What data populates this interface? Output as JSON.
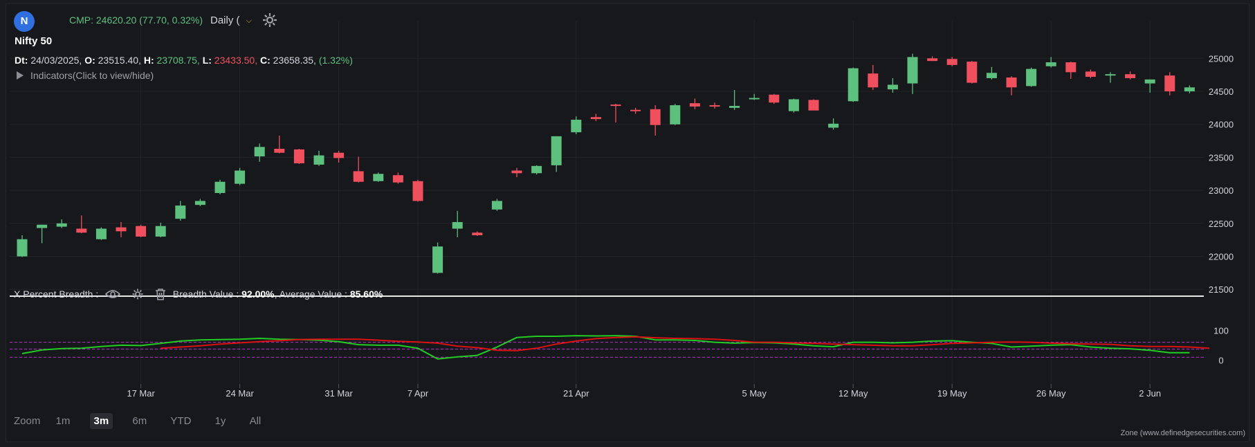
{
  "header": {
    "logo_letter": "N",
    "cmp_text": "CMP: 24620.20 (77.70, 0.32%)",
    "interval_label": "Daily (",
    "symbol_title": "Nifty 50"
  },
  "ohlc": {
    "dt_label": "Dt:",
    "dt_value": "24/03/2025,",
    "o_label": "O:",
    "o_value": "23515.40,",
    "h_label": "H:",
    "h_value": "23708.75,",
    "l_label": "L:",
    "l_value": "23433.50,",
    "c_label": "C:",
    "c_value": "23658.35,",
    "change": "(1.32%)"
  },
  "indicators_toggle": "Indicators(Click to view/hide)",
  "study": {
    "name": "X Percent Breadth :",
    "breadth_label": "Breadth Value :",
    "breadth_value": "92.00%",
    "sep": ", Average Value :",
    "average_value": "85.60%"
  },
  "zoom": {
    "label": "Zoom",
    "options": [
      "1m",
      "3m",
      "6m",
      "YTD",
      "1y",
      "All"
    ],
    "active": "3m"
  },
  "credit": "Zone (www.definedgesecurities.com)",
  "colors": {
    "up": "#5ec07f",
    "down": "#f0505e",
    "breadth_line": "#22cc22",
    "average_line": "#dd1111",
    "band_lines": "#c026d3"
  },
  "chart_data": [
    {
      "type": "candlestick",
      "title": "Nifty 50",
      "y_ticks": [
        21500,
        22000,
        22500,
        23000,
        23500,
        24000,
        24500,
        25000
      ],
      "ylim": [
        21450,
        25150
      ],
      "x_tick_labels": [
        "17 Mar",
        "24 Mar",
        "31 Mar",
        "7 Apr",
        "21 Apr",
        "5 May",
        "12 May",
        "19 May",
        "26 May",
        "2 Jun"
      ],
      "x_tick_session_index": [
        6,
        11,
        16,
        20,
        28,
        37,
        42,
        47,
        52,
        57
      ],
      "grid": true,
      "candles": [
        {
          "o": 22000,
          "h": 22320,
          "l": 21990,
          "c": 22260
        },
        {
          "o": 22430,
          "h": 22480,
          "l": 22200,
          "c": 22480
        },
        {
          "o": 22450,
          "h": 22560,
          "l": 22430,
          "c": 22500
        },
        {
          "o": 22420,
          "h": 22620,
          "l": 22350,
          "c": 22360
        },
        {
          "o": 22260,
          "h": 22440,
          "l": 22250,
          "c": 22420
        },
        {
          "o": 22440,
          "h": 22520,
          "l": 22290,
          "c": 22380
        },
        {
          "o": 22460,
          "h": 22480,
          "l": 22290,
          "c": 22300
        },
        {
          "o": 22300,
          "h": 22510,
          "l": 22290,
          "c": 22460
        },
        {
          "o": 22570,
          "h": 22840,
          "l": 22540,
          "c": 22770
        },
        {
          "o": 22780,
          "h": 22870,
          "l": 22760,
          "c": 22840
        },
        {
          "o": 22960,
          "h": 23160,
          "l": 22940,
          "c": 23130
        },
        {
          "o": 23100,
          "h": 23340,
          "l": 23080,
          "c": 23300
        },
        {
          "o": 23515,
          "h": 23709,
          "l": 23434,
          "c": 23658
        },
        {
          "o": 23630,
          "h": 23830,
          "l": 23560,
          "c": 23570
        },
        {
          "o": 23620,
          "h": 23630,
          "l": 23400,
          "c": 23410
        },
        {
          "o": 23390,
          "h": 23600,
          "l": 23370,
          "c": 23530
        },
        {
          "o": 23570,
          "h": 23600,
          "l": 23420,
          "c": 23490
        },
        {
          "o": 23290,
          "h": 23510,
          "l": 23120,
          "c": 23130
        },
        {
          "o": 23140,
          "h": 23270,
          "l": 23130,
          "c": 23250
        },
        {
          "o": 23230,
          "h": 23270,
          "l": 23100,
          "c": 23120
        },
        {
          "o": 23140,
          "h": 23160,
          "l": 22830,
          "c": 22840
        },
        {
          "o": 21750,
          "h": 22210,
          "l": 21740,
          "c": 22150
        },
        {
          "o": 22420,
          "h": 22690,
          "l": 22290,
          "c": 22520
        },
        {
          "o": 22360,
          "h": 22380,
          "l": 22310,
          "c": 22320
        },
        {
          "o": 22710,
          "h": 22870,
          "l": 22690,
          "c": 22840
        },
        {
          "o": 23300,
          "h": 23340,
          "l": 23200,
          "c": 23260
        },
        {
          "o": 23260,
          "h": 23380,
          "l": 23240,
          "c": 23370
        },
        {
          "o": 23380,
          "h": 23820,
          "l": 23280,
          "c": 23820
        },
        {
          "o": 23880,
          "h": 24120,
          "l": 23850,
          "c": 24070
        },
        {
          "o": 24110,
          "h": 24160,
          "l": 24050,
          "c": 24080
        },
        {
          "o": 24300,
          "h": 24310,
          "l": 24030,
          "c": 24280
        },
        {
          "o": 24220,
          "h": 24250,
          "l": 24160,
          "c": 24200
        },
        {
          "o": 24230,
          "h": 24290,
          "l": 23830,
          "c": 23990
        },
        {
          "o": 24000,
          "h": 24310,
          "l": 23990,
          "c": 24290
        },
        {
          "o": 24320,
          "h": 24390,
          "l": 24230,
          "c": 24270
        },
        {
          "o": 24290,
          "h": 24330,
          "l": 24240,
          "c": 24280
        },
        {
          "o": 24250,
          "h": 24520,
          "l": 24220,
          "c": 24280
        },
        {
          "o": 24380,
          "h": 24460,
          "l": 24370,
          "c": 24400
        },
        {
          "o": 24450,
          "h": 24460,
          "l": 24310,
          "c": 24330
        },
        {
          "o": 24200,
          "h": 24390,
          "l": 24180,
          "c": 24380
        },
        {
          "o": 24370,
          "h": 24380,
          "l": 24220,
          "c": 24210
        },
        {
          "o": 23950,
          "h": 24090,
          "l": 23920,
          "c": 24010
        },
        {
          "o": 24350,
          "h": 24860,
          "l": 24340,
          "c": 24850
        },
        {
          "o": 24770,
          "h": 24900,
          "l": 24520,
          "c": 24560
        },
        {
          "o": 24530,
          "h": 24700,
          "l": 24480,
          "c": 24600
        },
        {
          "o": 24620,
          "h": 25070,
          "l": 24460,
          "c": 25020
        },
        {
          "o": 25000,
          "h": 25030,
          "l": 24960,
          "c": 24960
        },
        {
          "o": 24990,
          "h": 25020,
          "l": 24880,
          "c": 24900
        },
        {
          "o": 24950,
          "h": 24960,
          "l": 24620,
          "c": 24630
        },
        {
          "o": 24700,
          "h": 24870,
          "l": 24680,
          "c": 24780
        },
        {
          "o": 24710,
          "h": 24730,
          "l": 24440,
          "c": 24560
        },
        {
          "o": 24580,
          "h": 24860,
          "l": 24570,
          "c": 24840
        },
        {
          "o": 24880,
          "h": 25020,
          "l": 24860,
          "c": 24940
        },
        {
          "o": 24940,
          "h": 24950,
          "l": 24690,
          "c": 24790
        },
        {
          "o": 24800,
          "h": 24830,
          "l": 24700,
          "c": 24720
        },
        {
          "o": 24740,
          "h": 24790,
          "l": 24630,
          "c": 24760
        },
        {
          "o": 24760,
          "h": 24800,
          "l": 24680,
          "c": 24700
        },
        {
          "o": 24620,
          "h": 24680,
          "l": 24480,
          "c": 24680
        },
        {
          "o": 24740,
          "h": 24790,
          "l": 24440,
          "c": 24500
        },
        {
          "o": 24500,
          "h": 24590,
          "l": 24470,
          "c": 24560
        }
      ]
    },
    {
      "type": "line",
      "title": "X Percent Breadth",
      "y_ticks": [
        0,
        100
      ],
      "ylim": [
        -8,
        110
      ],
      "bands": [
        10,
        37,
        60
      ],
      "series": [
        {
          "name": "Breadth Value",
          "color": "#22cc22",
          "start_index": 0,
          "values": [
            22,
            34,
            39,
            40,
            46,
            50,
            49,
            56,
            64,
            68,
            69,
            70,
            73,
            70,
            69,
            67,
            62,
            52,
            50,
            50,
            40,
            4,
            11,
            16,
            44,
            76,
            80,
            80,
            82,
            81,
            82,
            80,
            68,
            68,
            66,
            60,
            57,
            59,
            58,
            54,
            48,
            45,
            60,
            60,
            58,
            60,
            64,
            65,
            60,
            56,
            44,
            47,
            50,
            52,
            44,
            40,
            38,
            33,
            25,
            25
          ]
        },
        {
          "name": "Average Value",
          "color": "#dd1111",
          "start_index": 7,
          "values": [
            40,
            44,
            48,
            54,
            58,
            62,
            65,
            69,
            70,
            70,
            70,
            67,
            63,
            61,
            57,
            47,
            42,
            33,
            32,
            40,
            54,
            64,
            72,
            76,
            78,
            75,
            73,
            72,
            70,
            66,
            60,
            60,
            58,
            56,
            54,
            52,
            50,
            48,
            48,
            52,
            56,
            58,
            60,
            61,
            60,
            57,
            55,
            54,
            53,
            48,
            46,
            46,
            44,
            40
          ]
        }
      ]
    }
  ]
}
